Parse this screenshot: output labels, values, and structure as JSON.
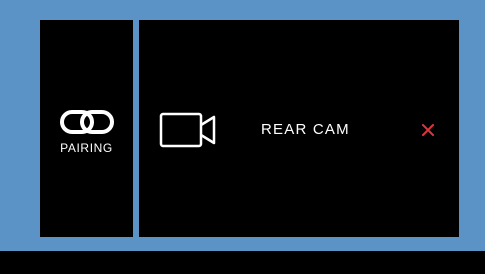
{
  "pairing": {
    "label": "PAIRING",
    "icon": "chain-link-icon"
  },
  "camera": {
    "label": "REAR CAM",
    "icon": "video-camera-icon",
    "remove_icon": "close-icon"
  },
  "colors": {
    "frame": "#5b93c7",
    "panel": "#000000",
    "text": "#ffffff",
    "remove": "#e0343d"
  }
}
